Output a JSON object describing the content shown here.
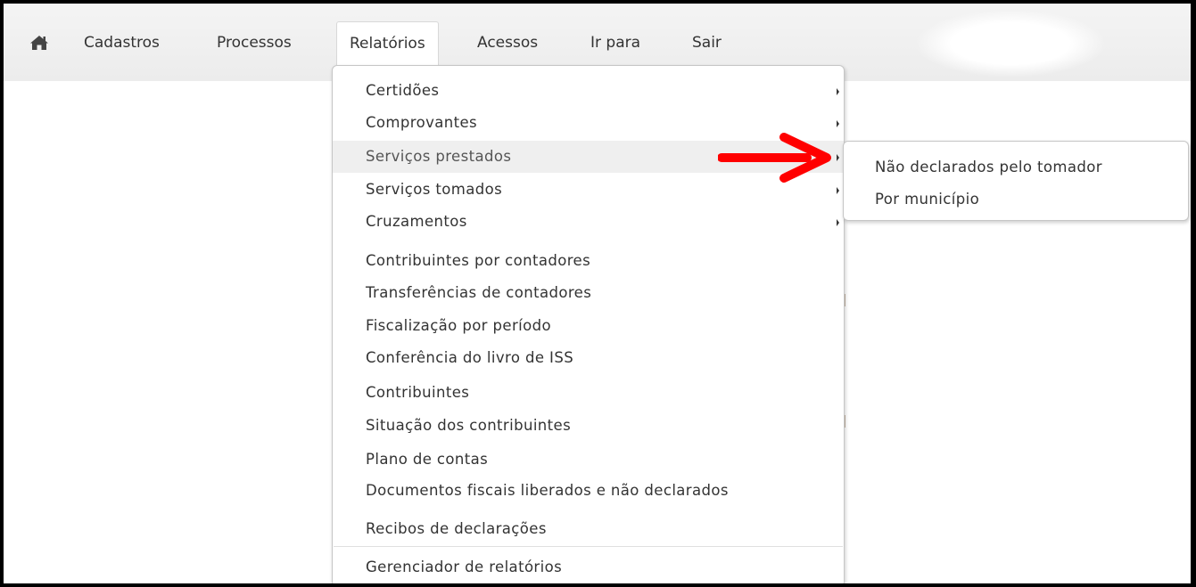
{
  "accent_color": "#ff0000",
  "nav": {
    "home_icon": "home-icon",
    "items": [
      {
        "label": "Cadastros"
      },
      {
        "label": "Processos"
      },
      {
        "label": "Relatórios"
      },
      {
        "label": "Acessos"
      },
      {
        "label": "Ir para"
      },
      {
        "label": "Sair"
      }
    ],
    "active": "Relatórios"
  },
  "menu": {
    "items": [
      {
        "label": "Certidões"
      },
      {
        "label": "Comprovantes"
      },
      {
        "label": "Serviços prestados"
      },
      {
        "label": "Serviços tomados"
      },
      {
        "label": "Cruzamentos"
      },
      {
        "label": "Contribuintes por contadores"
      },
      {
        "label": "Transferências de contadores"
      },
      {
        "label": "Fiscalização por período"
      },
      {
        "label": "Conferência do livro de ISS"
      },
      {
        "label": "Contribuintes"
      },
      {
        "label": "Situação dos contribuintes"
      },
      {
        "label": "Plano de contas"
      },
      {
        "label": "Documentos fiscais liberados e não declarados"
      },
      {
        "label": "Recibos de declarações"
      },
      {
        "label": "Gerenciador de relatórios"
      }
    ],
    "highlighted": "Serviços prestados"
  },
  "submenu": {
    "items": [
      {
        "label": "Não declarados pelo tomador"
      },
      {
        "label": "Por município"
      }
    ]
  }
}
